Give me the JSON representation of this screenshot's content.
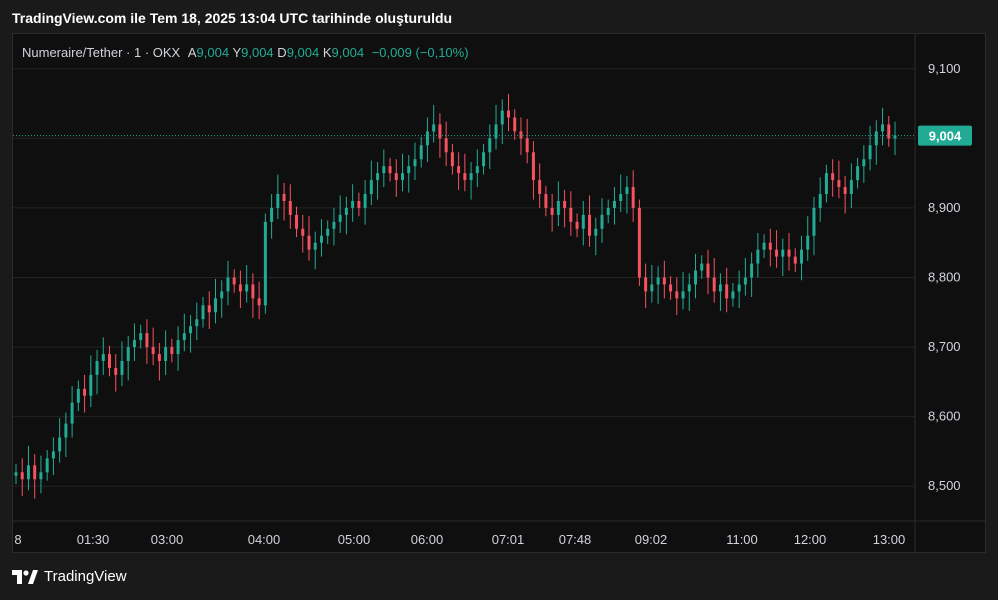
{
  "header": {
    "title": "TradingView.com ile Tem 18, 2025 13:04 UTC tarihinde oluşturuldu"
  },
  "legend": {
    "symbol": "Numeraire/Tether · 1 · OKX",
    "open_label": "A",
    "open": "9,004",
    "high_label": "Y",
    "high": "9,004",
    "low_label": "D",
    "low": "9,004",
    "close_label": "K",
    "close": "9,004",
    "change": "−0,009 (−0,10%)"
  },
  "footer": {
    "brand": "TradingView"
  },
  "colors": {
    "up": "#22ab94",
    "down": "#f7525f",
    "grid": "#232323",
    "axis_text": "#d1d4dc",
    "price_tag": "#22ab94",
    "price_line": "#22ab94"
  },
  "chart_data": {
    "type": "candlestick",
    "title": "",
    "xlabel": "",
    "ylabel": "",
    "ylim": [
      8.45,
      9.15
    ],
    "y_ticks": [
      "8,500",
      "8,600",
      "8,700",
      "8,800",
      "8,900",
      "9,000",
      "9,100"
    ],
    "y_tick_values": [
      8.5,
      8.6,
      8.7,
      8.8,
      8.9,
      9.0,
      9.1
    ],
    "x_tick_labels": [
      "8",
      "01:30",
      "03:00",
      "04:00",
      "05:00",
      "06:00",
      "07:01",
      "07:48",
      "09:02",
      "11:00",
      "12:00",
      "13:00"
    ],
    "last_price": 9.004,
    "last_price_label": "9,004",
    "grid": true,
    "series": [
      {
        "values": [
          8.52,
          8.51,
          8.53,
          8.51,
          8.52,
          8.54,
          8.55,
          8.57,
          8.59,
          8.62,
          8.64,
          8.63,
          8.66,
          8.68,
          8.69,
          8.67,
          8.66,
          8.68,
          8.7,
          8.71,
          8.72,
          8.7,
          8.69,
          8.68,
          8.7,
          8.69,
          8.71,
          8.72,
          8.73,
          8.74,
          8.76,
          8.75,
          8.77,
          8.78,
          8.8,
          8.79,
          8.78,
          8.79,
          8.77,
          8.76,
          8.88,
          8.9,
          8.92,
          8.91,
          8.89,
          8.87,
          8.86,
          8.84,
          8.85,
          8.86,
          8.87,
          8.88,
          8.89,
          8.9,
          8.91,
          8.9,
          8.92,
          8.94,
          8.95,
          8.96,
          8.95,
          8.94,
          8.95,
          8.96,
          8.97,
          8.99,
          9.01,
          9.02,
          9.0,
          8.98,
          8.96,
          8.95,
          8.94,
          8.95,
          8.96,
          8.98,
          9.0,
          9.02,
          9.04,
          9.03,
          9.01,
          9.0,
          8.98,
          8.94,
          8.92,
          8.9,
          8.89,
          8.91,
          8.9,
          8.88,
          8.87,
          8.89,
          8.86,
          8.87,
          8.89,
          8.9,
          8.91,
          8.92,
          8.93,
          8.9,
          8.8,
          8.78,
          8.79,
          8.8,
          8.79,
          8.78,
          8.77,
          8.78,
          8.79,
          8.81,
          8.82,
          8.8,
          8.78,
          8.79,
          8.77,
          8.78,
          8.79,
          8.8,
          8.82,
          8.84,
          8.85,
          8.84,
          8.83,
          8.84,
          8.83,
          8.82,
          8.84,
          8.86,
          8.9,
          8.92,
          8.95,
          8.94,
          8.93,
          8.92,
          8.94,
          8.96,
          8.97,
          8.99,
          9.01,
          9.02,
          9.0,
          9.004
        ]
      }
    ]
  }
}
